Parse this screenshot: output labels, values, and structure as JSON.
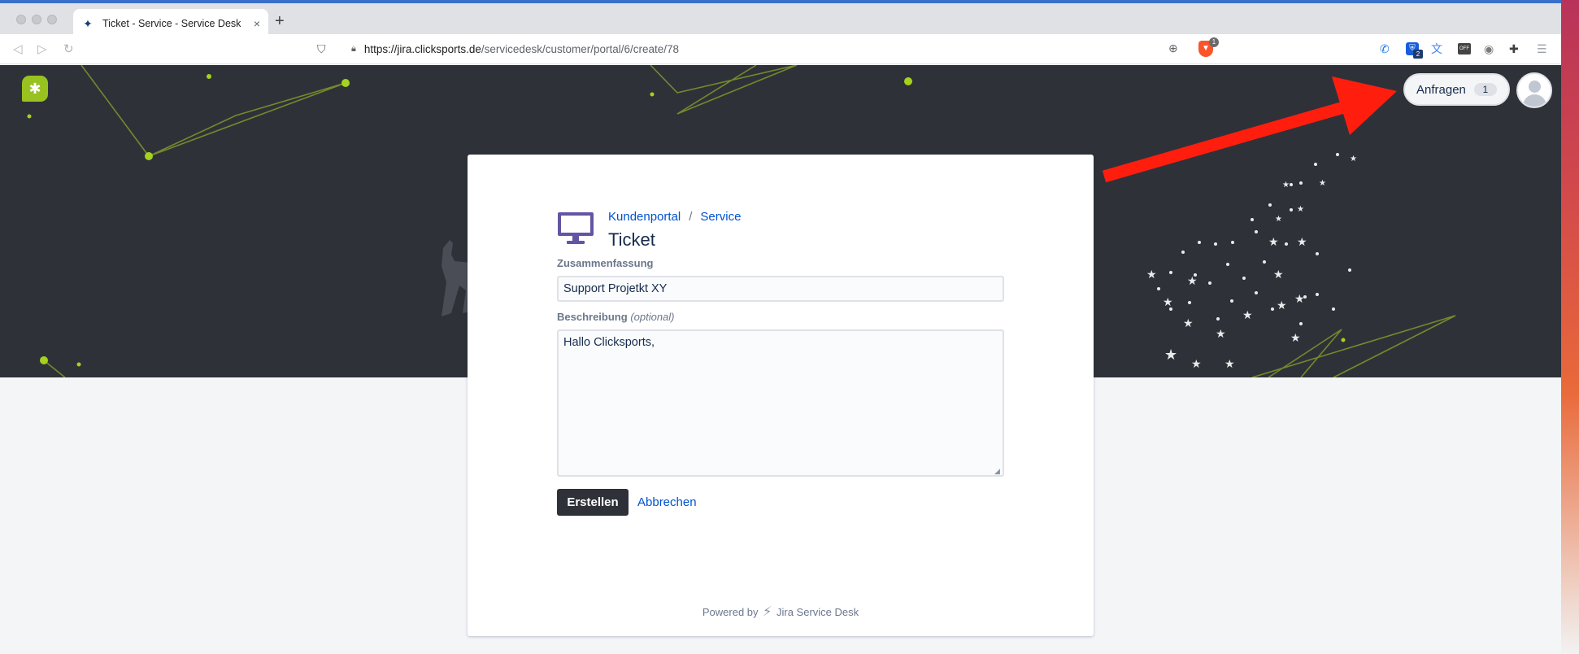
{
  "browser": {
    "tab_title": "Ticket - Service - Service Desk",
    "new_tab": "+",
    "close": "×",
    "url_host": "https://jira.clicksports.de",
    "url_path": "/servicedesk/customer/portal/6/create/78",
    "brave_badge": "1",
    "bitwarden_badge": "2",
    "off_ext_label": "OFF"
  },
  "header": {
    "requests_label": "Anfragen",
    "requests_count": "1"
  },
  "breadcrumb": {
    "portal": "Kundenportal",
    "separator": "/",
    "service": "Service"
  },
  "page": {
    "title": "Ticket"
  },
  "form": {
    "summary_label": "Zusammenfassung",
    "summary_value": "Support Projetkt XY",
    "description_label": "Beschreibung",
    "description_optional": "(optional)",
    "description_value": "Hallo Clicksports,",
    "create_label": "Erstellen",
    "cancel_label": "Abbrechen"
  },
  "footer": {
    "powered_by": "Powered by",
    "product": "Jira Service Desk"
  },
  "colors": {
    "hero_bg": "#2f3139",
    "accent_green": "#98c21f",
    "link_blue": "#0052cc",
    "arrow_red": "#ff1e0e",
    "monitor_purple": "#6554a3"
  }
}
